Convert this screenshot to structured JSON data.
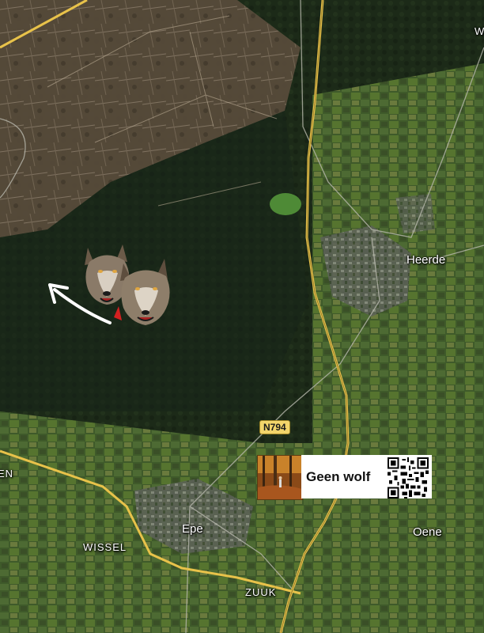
{
  "map": {
    "type": "satellite",
    "places": {
      "heerde": "Heerde",
      "epe": "Epe",
      "oene": "Oene",
      "wissel": "WISSEL",
      "zuuk": "ZUUK",
      "edge_left": "EN",
      "edge_top_right": "W"
    },
    "road_shield": "N794",
    "road_color": "#e8c24a"
  },
  "annotation": {
    "card_text": "Geen wolf",
    "wolf_icon": "wolf-pair-icon",
    "arrow_icon": "curved-arrow-icon",
    "qr_icon": "qr-code-icon"
  }
}
